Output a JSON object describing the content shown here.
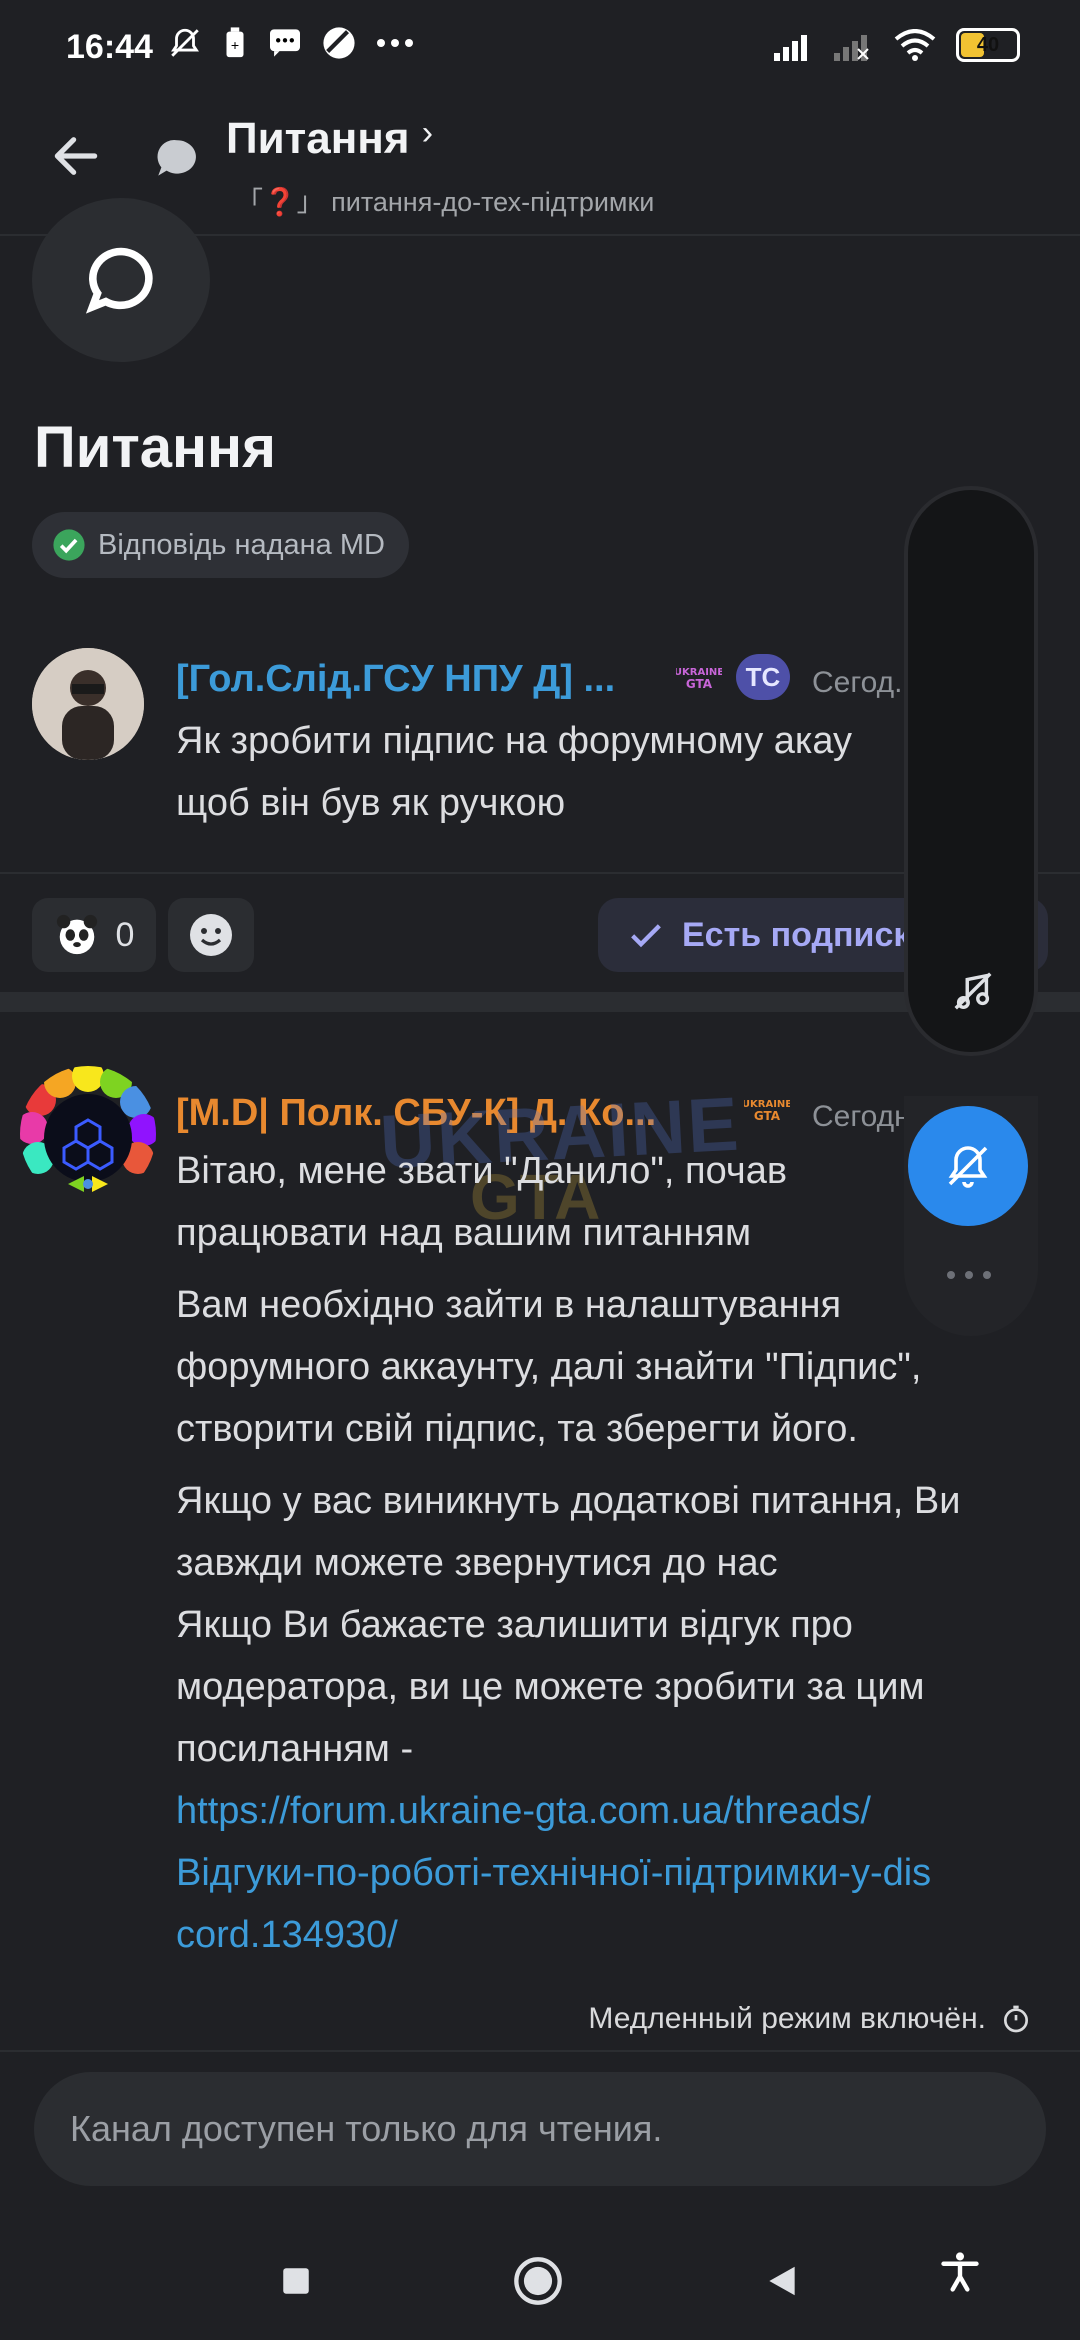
{
  "status_bar": {
    "time": "16:44",
    "battery": "40"
  },
  "header": {
    "title": "Питання",
    "title_chevron": "›",
    "subtitle": "「❓」 питання-до-тех-підтримки"
  },
  "thread": {
    "title": "Питання",
    "answer_badge": "Відповідь надана MD"
  },
  "first_message": {
    "username": "[Гол.Слід.ГСУ НПУ Д] ...",
    "op_badge": "TC",
    "timestamp": "Сегод...0",
    "text_line1": "Як зробити підпис на форумному акау",
    "text_line2": "щоб він був як ручкою",
    "reaction_count": "0",
    "reply_button": "Есть подписк"
  },
  "second_message": {
    "username": "[M.D| Полк. СБУ-К] Д. Ко...",
    "timestamp": "Сегодн...33",
    "para1_line1": "Вітаю, мене звати \"Данило\", почав",
    "para1_line2": "працювати над вашим питанням",
    "para2_line1": "Вам необхідно зайти в налаштування",
    "para2_line2": "форумного аккаунту, далі знайти \"Підпис\",",
    "para2_line3": "створити свій підпис, та зберегти його.",
    "para3_line1": "Якщо у вас виникнуть додаткові питання, Ви",
    "para3_line2": "завжди можете звернутися до нас",
    "para3_line3": "Якщо Ви бажаєте залишити відгук про",
    "para3_line4": "модератора, ви це можете зробити за цим",
    "para3_line5": "посиланням -",
    "link_line1": "https://forum.ukraine-gta.com.ua/threads/",
    "link_line2": "Відгуки-по-роботі-технічної-підтримки-у-dis",
    "link_line3": "cord.134930/"
  },
  "watermark": {
    "line1": "UKRAINE",
    "line2": "GTA"
  },
  "footer": {
    "slow_mode": "Медленный режим включён.",
    "input_placeholder": "Канал доступен только для чтения."
  },
  "colors": {
    "accent": "#2a89ec",
    "username1": "#3c9bd9",
    "username2": "#e8892f",
    "link": "#3c9bd9",
    "background": "#1f2024"
  },
  "icons": [
    "back-arrow-icon",
    "thread-bubble-icon",
    "checkmark-circle-icon",
    "emoji-add-icon",
    "check-icon",
    "bell-off-icon",
    "music-off-icon",
    "more-dots-icon",
    "timer-icon"
  ]
}
